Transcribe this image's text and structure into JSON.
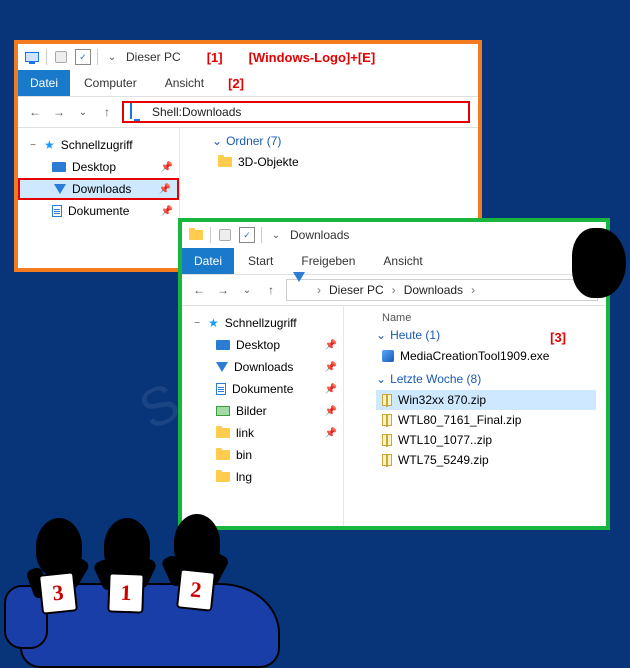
{
  "annotations": {
    "a1": "[1]",
    "a1_text": "[Windows-Logo]+[E]",
    "a2": "[2]",
    "a3": "[3]"
  },
  "window1": {
    "title": "Dieser PC",
    "menu": {
      "file": "Datei",
      "tabs": [
        "Computer",
        "Ansicht"
      ]
    },
    "address": "Shell:Downloads",
    "tree": {
      "root": "Schnellzugriff",
      "items": [
        {
          "label": "Desktop"
        },
        {
          "label": "Downloads",
          "selected": true
        },
        {
          "label": "Dokumente"
        }
      ]
    },
    "content": {
      "group": "Ordner (7)",
      "items": [
        {
          "label": "3D-Objekte"
        }
      ]
    }
  },
  "window2": {
    "title": "Downloads",
    "menu": {
      "file": "Datei",
      "tabs": [
        "Start",
        "Freigeben",
        "Ansicht"
      ]
    },
    "breadcrumb": [
      "Dieser PC",
      "Downloads"
    ],
    "column_header": "Name",
    "tree": {
      "root": "Schnellzugriff",
      "items": [
        {
          "label": "Desktop"
        },
        {
          "label": "Downloads"
        },
        {
          "label": "Dokumente"
        },
        {
          "label": "Bilder"
        },
        {
          "label": "link"
        },
        {
          "label": "bin"
        },
        {
          "label": "lng"
        }
      ]
    },
    "groups": [
      {
        "header": "Heute (1)",
        "items": [
          {
            "label": "MediaCreationTool1909.exe",
            "type": "exe"
          }
        ]
      },
      {
        "header": "Letzte Woche (8)",
        "items": [
          {
            "label": "Win32xx 870.zip",
            "type": "zip",
            "selected": true
          },
          {
            "label": "WTL80_7161_Final.zip",
            "type": "zip"
          },
          {
            "label": "WTL10_1077..zip",
            "type": "zip"
          },
          {
            "label": "WTL75_5249.zip",
            "type": "zip"
          }
        ]
      }
    ]
  },
  "cards": {
    "c3": "3",
    "c1": "1",
    "c2": "2"
  },
  "watermark": "SoftwareOK.de"
}
